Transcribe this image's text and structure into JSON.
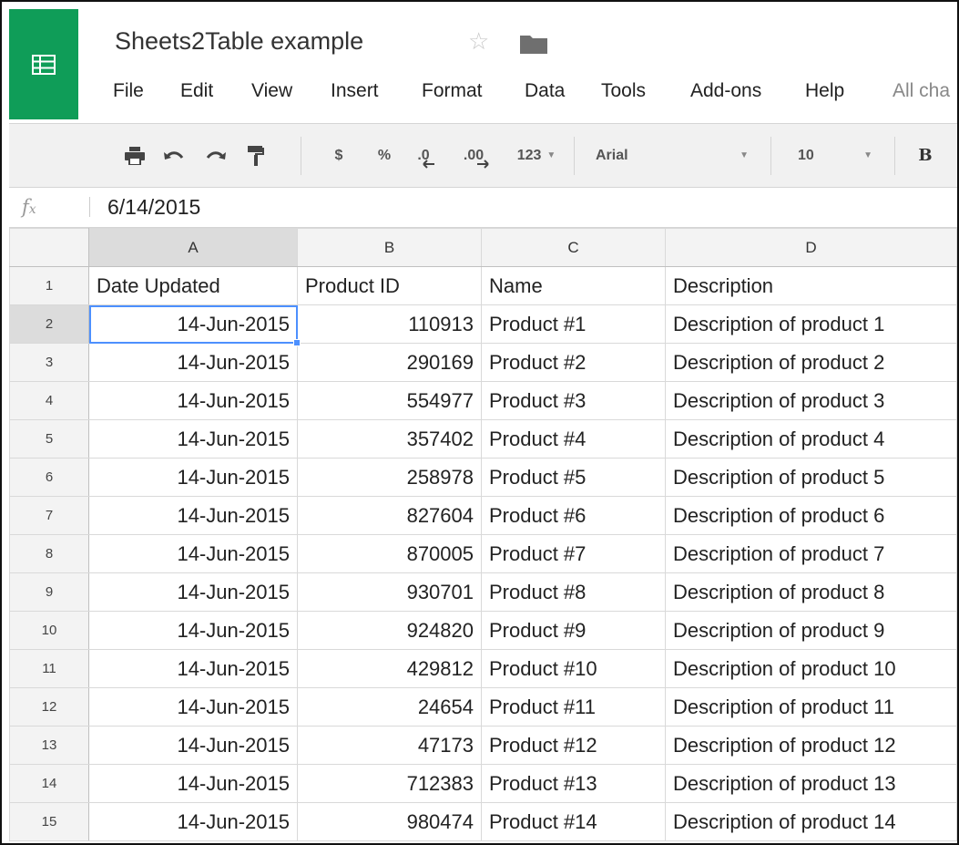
{
  "document": {
    "title": "Sheets2Table example"
  },
  "menu": {
    "file": "File",
    "edit": "Edit",
    "view": "View",
    "insert": "Insert",
    "format": "Format",
    "data": "Data",
    "tools": "Tools",
    "addons": "Add-ons",
    "help": "Help",
    "all_changes": "All cha"
  },
  "toolbar": {
    "currency": "$",
    "percent": "%",
    "decrease_decimals": ".0",
    "increase_decimals": ".00",
    "more_formats": "123",
    "font_family": "Arial",
    "font_size": "10",
    "bold": "B",
    "icons": [
      "print-icon",
      "undo-icon",
      "redo-icon",
      "paint-format-icon",
      "star-icon",
      "folder-icon",
      "sheets-logo-icon"
    ]
  },
  "formula_bar": {
    "fx_label": "fx",
    "value": "6/14/2015"
  },
  "sheet": {
    "column_letters": [
      "A",
      "B",
      "C",
      "D"
    ],
    "row_numbers": [
      "1",
      "2",
      "3",
      "4",
      "5",
      "6",
      "7",
      "8",
      "9",
      "10",
      "11",
      "12",
      "13",
      "14",
      "15"
    ],
    "rows": [
      [
        "Date Updated",
        "Product ID",
        "Name",
        "Description"
      ],
      [
        "14-Jun-2015",
        "110913",
        "Product #1",
        "Description of product 1"
      ],
      [
        "14-Jun-2015",
        "290169",
        "Product #2",
        "Description of product 2"
      ],
      [
        "14-Jun-2015",
        "554977",
        "Product #3",
        "Description of product 3"
      ],
      [
        "14-Jun-2015",
        "357402",
        "Product #4",
        "Description of product 4"
      ],
      [
        "14-Jun-2015",
        "258978",
        "Product #5",
        "Description of product 5"
      ],
      [
        "14-Jun-2015",
        "827604",
        "Product #6",
        "Description of product 6"
      ],
      [
        "14-Jun-2015",
        "870005",
        "Product #7",
        "Description of product 7"
      ],
      [
        "14-Jun-2015",
        "930701",
        "Product #8",
        "Description of product 8"
      ],
      [
        "14-Jun-2015",
        "924820",
        "Product #9",
        "Description of product 9"
      ],
      [
        "14-Jun-2015",
        "429812",
        "Product #10",
        "Description of product 10"
      ],
      [
        "14-Jun-2015",
        "24654",
        "Product #11",
        "Description of product 11"
      ],
      [
        "14-Jun-2015",
        "47173",
        "Product #12",
        "Description of product 12"
      ],
      [
        "14-Jun-2015",
        "712383",
        "Product #13",
        "Description of product 13"
      ],
      [
        "14-Jun-2015",
        "980474",
        "Product #14",
        "Description of product 14"
      ]
    ],
    "active_cell": "A2"
  },
  "colors": {
    "brand_green": "#0f9d58",
    "selection_blue": "#4d90fe",
    "header_gray": "#f3f3f3",
    "toolbar_gray": "#f1f1f1"
  }
}
